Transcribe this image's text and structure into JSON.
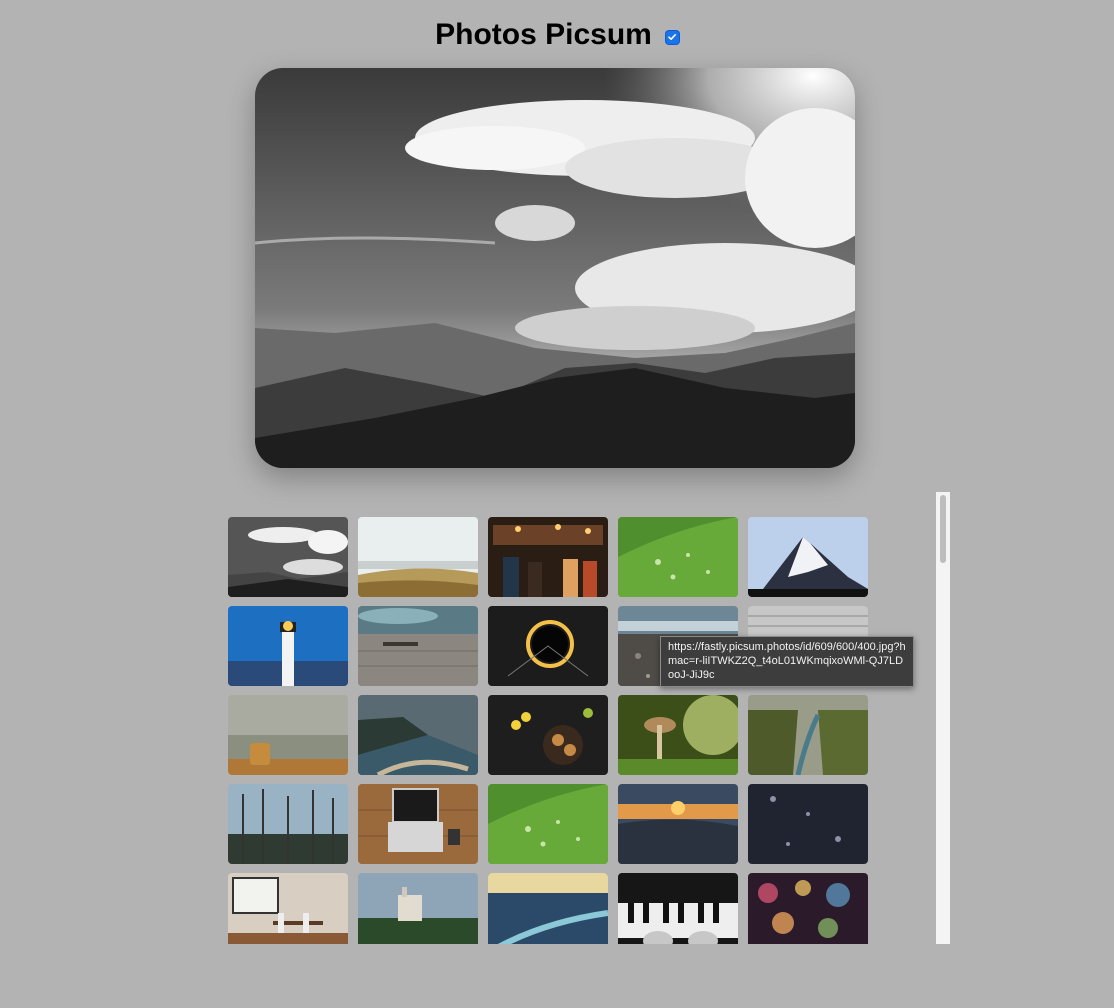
{
  "header": {
    "title": "Photos Picsum",
    "toggle_checked": true
  },
  "hero": {
    "icon": "mountain-clouds-photo"
  },
  "gallery": {
    "thumbnails": [
      {
        "icon": "bw-clouds-mountains-photo"
      },
      {
        "icon": "dune-grass-photo"
      },
      {
        "icon": "crowded-bar-photo"
      },
      {
        "icon": "green-leaf-droplets-photo"
      },
      {
        "icon": "snowy-peak-photo"
      },
      {
        "icon": "lighthouse-night-photo"
      },
      {
        "icon": "wooden-pier-ocean-photo"
      },
      {
        "icon": "light-ring-photo"
      },
      {
        "icon": "pebble-beach-photo"
      },
      {
        "icon": "grey-wall-photo"
      },
      {
        "icon": "foggy-field-hay-bale-photo"
      },
      {
        "icon": "coastal-cliffs-photo"
      },
      {
        "icon": "cookies-flowers-photo"
      },
      {
        "icon": "mushroom-macro-photo"
      },
      {
        "icon": "mossy-canyon-photo"
      },
      {
        "icon": "bare-forest-photo"
      },
      {
        "icon": "laptop-desk-photo"
      },
      {
        "icon": "green-leaf-droplets-photo"
      },
      {
        "icon": "sunset-skatepark-photo"
      },
      {
        "icon": "wet-glass-photo"
      },
      {
        "icon": "dining-room-photo"
      },
      {
        "icon": "castle-forest-photo"
      },
      {
        "icon": "river-valley-photo"
      },
      {
        "icon": "piano-hands-photo"
      },
      {
        "icon": "bokeh-lights-photo"
      }
    ]
  },
  "tooltip": {
    "text": "https://fastly.picsum.photos/id/609/600/400.jpg?hmac=r-liITWKZ2Q_t4oL01WKmqixoWMl-QJ7LDooJ-JiJ9c"
  },
  "colors": {
    "background": "#b3b3b3",
    "checkbox": "#1a73e8",
    "tooltip_bg": "#3d3d3d"
  }
}
